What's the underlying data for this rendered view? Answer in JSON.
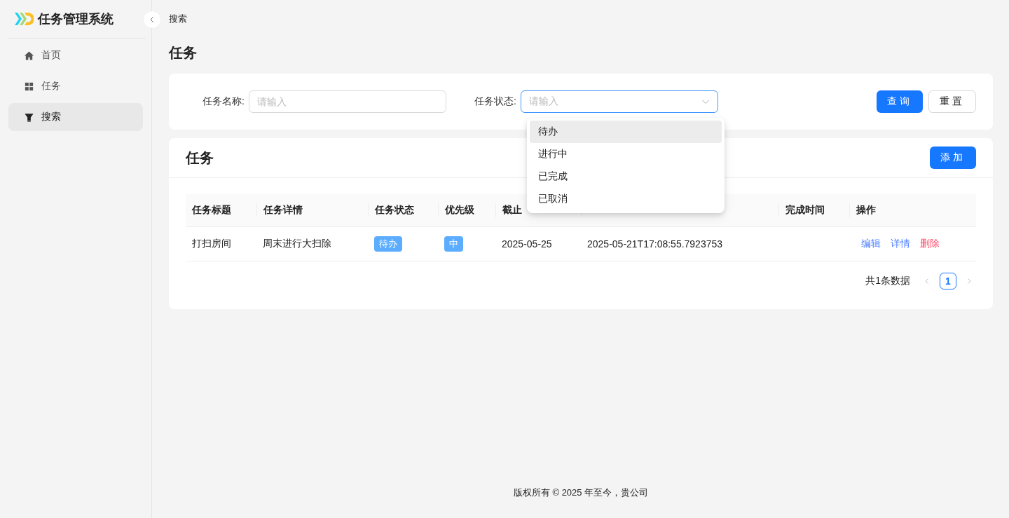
{
  "sidebar": {
    "logo_text": "任务管理系统",
    "items": [
      {
        "label": "首页",
        "selected": false
      },
      {
        "label": "任务",
        "selected": false
      },
      {
        "label": "搜索",
        "selected": true
      }
    ]
  },
  "breadcrumb": "搜索",
  "page_title": "任务",
  "search_form": {
    "fields": [
      {
        "label": "任务名称:",
        "placeholder": "请输入",
        "kind": "input",
        "focused": false
      },
      {
        "label": "任务状态:",
        "placeholder": "请输入",
        "kind": "select",
        "focused": true
      }
    ],
    "buttons": [
      {
        "label": "查询",
        "kind": "primary"
      },
      {
        "label": "重置",
        "kind": "default"
      }
    ]
  },
  "dropdown": {
    "options": [
      {
        "label": "待办",
        "selected": true
      },
      {
        "label": "进行中",
        "selected": false
      },
      {
        "label": "已完成",
        "selected": false
      },
      {
        "label": "已取消",
        "selected": false
      }
    ]
  },
  "table_card": {
    "title": "任务",
    "add_button": "添加",
    "columns": [
      "任务标题",
      "任务详情",
      "任务状态",
      "优先级",
      "截止",
      null,
      "完成时间",
      "操作"
    ],
    "rows": [
      {
        "title": "打扫房间",
        "detail": "周末进行大扫除",
        "status": "待办",
        "priority": "中",
        "deadline": "2025-05-25",
        "created": "2025-05-21T17:08:55.7923753",
        "completed": null,
        "actions": [
          {
            "label": "编辑",
            "kind": "link"
          },
          {
            "label": "详情",
            "kind": "link"
          },
          {
            "label": "删除",
            "kind": "danger"
          }
        ]
      }
    ],
    "pagination": {
      "total": "共1条数据",
      "prev_disabled": true,
      "next_disabled": true,
      "pages": [
        {
          "label": "1",
          "selected": true
        }
      ]
    }
  },
  "footer": "版权所有 © 2025 年至今，贵公司"
}
